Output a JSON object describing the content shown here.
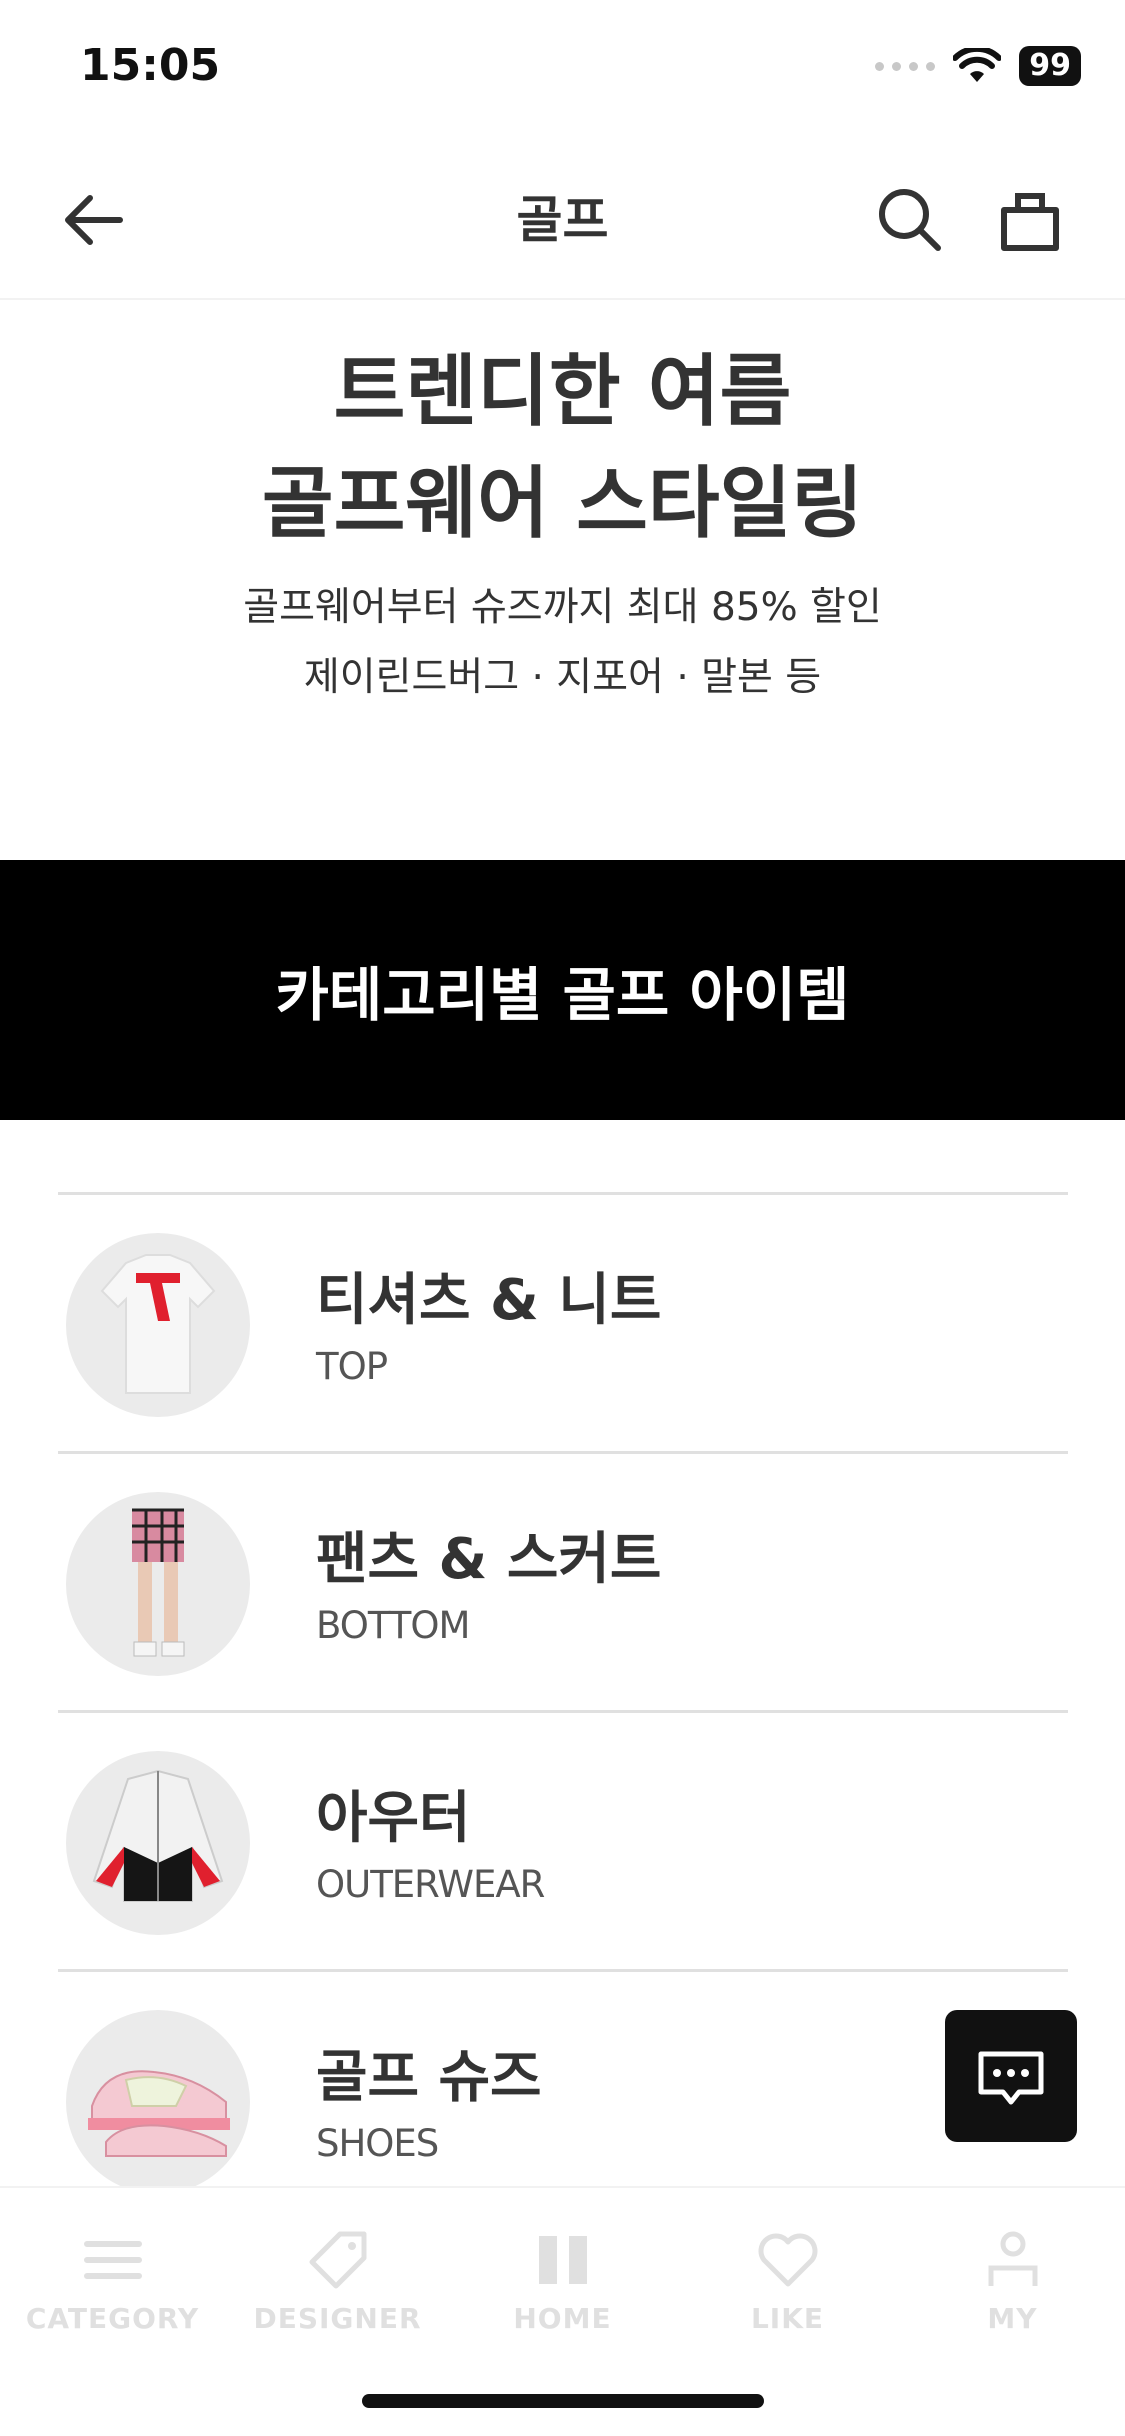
{
  "status_bar": {
    "time": "15:05",
    "battery": "99"
  },
  "header": {
    "title": "골프"
  },
  "hero": {
    "title_line1": "트렌디한 여름",
    "title_line2": "골프웨어 스타일링",
    "subtitle_line1": "골프웨어부터 슈즈까지 최대 85% 할인",
    "subtitle_line2": "제이린드버그 · 지포어 · 말본 등"
  },
  "banner": {
    "text": "카테고리별 골프 아이템"
  },
  "categories": [
    {
      "name": "티셔츠 & 니트",
      "sub": "TOP"
    },
    {
      "name": "팬츠 & 스커트",
      "sub": "BOTTOM"
    },
    {
      "name": "아우터",
      "sub": "OUTERWEAR"
    },
    {
      "name": "골프 슈즈",
      "sub": "SHOES"
    }
  ],
  "bottom_nav": [
    {
      "label": "CATEGORY",
      "icon": "menu-icon"
    },
    {
      "label": "DESIGNER",
      "icon": "tag-icon"
    },
    {
      "label": "HOME",
      "icon": "home-icon"
    },
    {
      "label": "LIKE",
      "icon": "heart-icon"
    },
    {
      "label": "MY",
      "icon": "person-icon"
    }
  ],
  "colors": {
    "banner_bg": "#000000",
    "text": "#333333",
    "nav_inactive": "#e0e0e0",
    "accent_red": "#e0202e"
  }
}
